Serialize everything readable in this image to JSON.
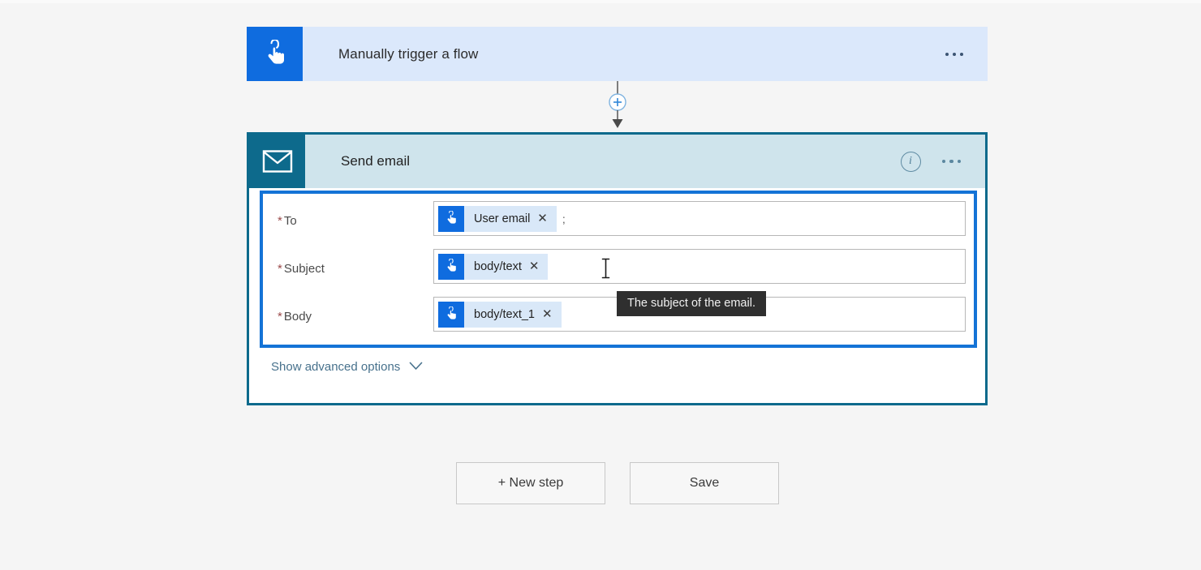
{
  "trigger": {
    "title": "Manually trigger a flow",
    "icon": "tap-hand-icon",
    "menu_icon": "ellipsis-icon",
    "bg_color": "#dbe8fb",
    "accent_color": "#0f6cdf"
  },
  "connector": {
    "add_icon": "plus-circle-icon",
    "arrow_icon": "arrow-down-icon"
  },
  "action": {
    "title": "Send email",
    "icon": "envelope-icon",
    "info_icon": "info-circle-icon",
    "menu_icon": "ellipsis-icon",
    "header_bg": "#cfe4ec",
    "accent_color": "#0d6a8c",
    "focus_ring_color": "#1473d6",
    "fields": [
      {
        "label": "To",
        "required": true,
        "required_marker": "*",
        "token": {
          "text": "User email",
          "icon": "tap-hand-icon",
          "remove_icon": "close-icon"
        },
        "trailing_text": ";"
      },
      {
        "label": "Subject",
        "required": true,
        "required_marker": "*",
        "token": {
          "text": "body/text",
          "icon": "tap-hand-icon",
          "remove_icon": "close-icon"
        },
        "trailing_text": ""
      },
      {
        "label": "Body",
        "required": true,
        "required_marker": "*",
        "token": {
          "text": "body/text_1",
          "icon": "tap-hand-icon",
          "remove_icon": "close-icon"
        },
        "trailing_text": ""
      }
    ],
    "advanced_options": {
      "label": "Show advanced options",
      "chevron_icon": "chevron-down-icon"
    }
  },
  "tooltip": {
    "text": "The subject of the email.",
    "bg_color": "#2f2f2f"
  },
  "footer": {
    "new_step_label": "+ New step",
    "save_label": "Save"
  }
}
